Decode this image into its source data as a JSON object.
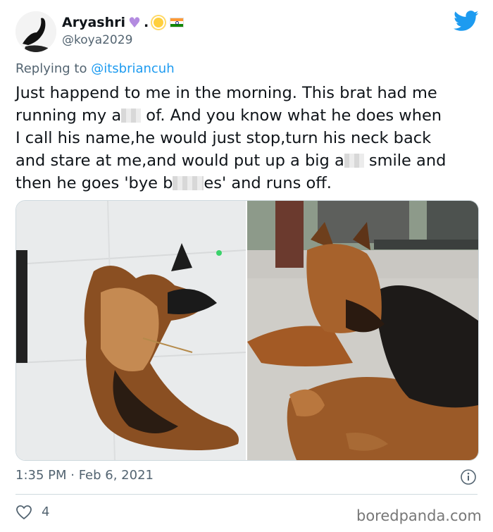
{
  "user": {
    "display_name": "Aryashri",
    "name_suffix": ".",
    "handle": "@koya2029"
  },
  "reply": {
    "prefix": "Replying to ",
    "mention": "@itsbriancuh"
  },
  "tweet": {
    "segments": [
      "Just happend to me in the morning. This brat had me\nrunning my a",
      " of. And you know what he does when\nI call his name,he would just stop,turn his neck back\nand stare at me,and would put up a big a",
      " smile and\nthen he goes 'bye b",
      "es' and runs off."
    ]
  },
  "meta": {
    "timestamp": "1:35 PM · Feb 6, 2021",
    "likes": "4"
  },
  "watermark": "boredpanda.com",
  "colors": {
    "accent": "#1d9bf0",
    "secondary_text": "#536471",
    "heart_emoji": "#b38be0"
  },
  "icons": {
    "brand": "twitter-bird-icon",
    "info": "info-icon",
    "like": "heart-outline-icon"
  }
}
